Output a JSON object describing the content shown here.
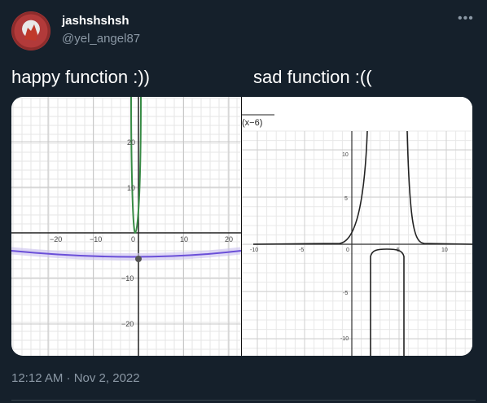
{
  "tweet": {
    "display_name": "jashshshsh",
    "handle": "@yel_angel87",
    "more_icon": "more-horizontal-icon",
    "left_caption": "happy function :))",
    "right_caption": "sad function :((",
    "timestamp": "12:12 AM · Nov 2, 2022"
  },
  "left_graph": {
    "x_ticks": [
      "−20",
      "−10",
      "0",
      "10",
      "20"
    ],
    "y_ticks": [
      "20",
      "10",
      "−10",
      "−20"
    ],
    "curve_colors": {
      "parabola": "#2d70b3",
      "narrow": "#388c46",
      "vertex": "#555555"
    }
  },
  "right_graph": {
    "formula_fragment": "(x−6)",
    "x_ticks": [
      "-10",
      "-5",
      "0",
      "5",
      "10"
    ],
    "y_ticks": [
      "10",
      "5",
      "-5",
      "-10"
    ],
    "curve_color": "#222222"
  },
  "colors": {
    "background": "#15202b",
    "muted": "#8b98a5"
  }
}
